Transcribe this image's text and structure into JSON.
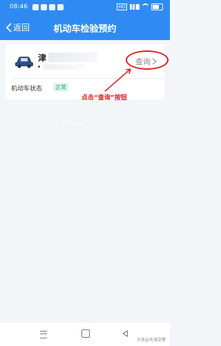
{
  "status_bar": {
    "time": "08:46",
    "network_badge": "HD"
  },
  "navbar": {
    "back_label": "返回",
    "title": "机动车检验预约"
  },
  "vehicle_card": {
    "plate_prefix": "津",
    "query_label": "查询",
    "status_label": "机动车状态",
    "status_value": "正常"
  },
  "annotation": {
    "text": "点击“查询”按钮",
    "color": "#e21b1b"
  },
  "watermark": "头条@天津交警",
  "colors": {
    "primary": "#2f8bf3",
    "badge_text": "#19a46a",
    "badge_bg": "#e2f6ec"
  }
}
